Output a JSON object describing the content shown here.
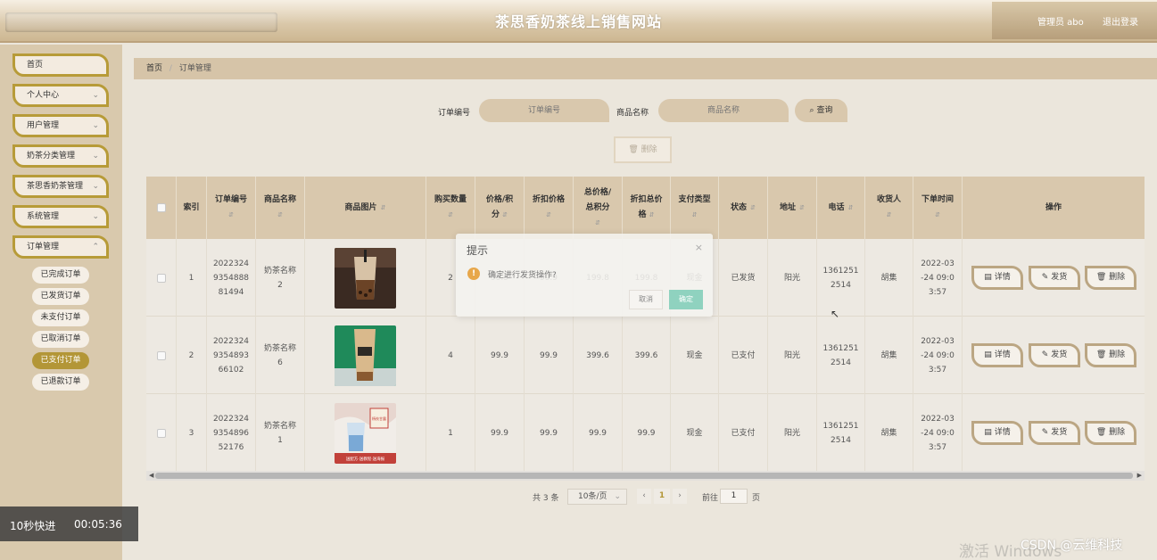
{
  "header": {
    "title": "茶思香奶茶线上销售网站",
    "admin_label": "管理员 abo",
    "logout_label": "退出登录"
  },
  "sidebar": {
    "items": [
      {
        "label": "首页",
        "has_chevron": false
      },
      {
        "label": "个人中心",
        "has_chevron": true
      },
      {
        "label": "用户管理",
        "has_chevron": true
      },
      {
        "label": "奶茶分类管理",
        "has_chevron": true
      },
      {
        "label": "茶思香奶茶管理",
        "has_chevron": true
      },
      {
        "label": "系统管理",
        "has_chevron": true
      },
      {
        "label": "订单管理",
        "has_chevron": true
      }
    ],
    "sub_items": [
      {
        "label": "已完成订单",
        "active": false
      },
      {
        "label": "已发货订单",
        "active": false
      },
      {
        "label": "未支付订单",
        "active": false
      },
      {
        "label": "已取消订单",
        "active": false
      },
      {
        "label": "已支付订单",
        "active": true
      },
      {
        "label": "已退款订单",
        "active": false
      }
    ]
  },
  "breadcrumb": {
    "home": "首页",
    "separator": "/",
    "current": "订单管理"
  },
  "search": {
    "order_no_label": "订单编号",
    "order_no_placeholder": "订单编号",
    "product_name_label": "商品名称",
    "product_name_placeholder": "商品名称",
    "query_label": "查询",
    "delete_label": "删除"
  },
  "table": {
    "headers": {
      "index": "索引",
      "order_no": "订单编号",
      "product_name": "商品名称",
      "product_image": "商品图片",
      "quantity": "购买数量",
      "price_line1": "价格/积",
      "price_line2": "分",
      "discount_price": "折扣价格",
      "total_line1": "总价格/",
      "total_line2": "总积分",
      "discount_total_line1": "折扣总价",
      "discount_total_line2": "格",
      "pay_type_line1": "支付类型",
      "status": "状态",
      "address": "地址",
      "phone": "电话",
      "receiver": "收货人",
      "order_time": "下单时间",
      "actions": "操作"
    },
    "rows": [
      {
        "index": "1",
        "order_no_1": "2022324",
        "order_no_2": "9354888",
        "order_no_3": "81494",
        "product_1": "奶茶名称",
        "product_2": "2",
        "quantity": "2",
        "price": "99.9",
        "discount_price": "99.9",
        "total": "199.8",
        "discount_total": "199.8",
        "pay_type": "现金",
        "status": "已发货",
        "address": "阳光",
        "phone_1": "1361251",
        "phone_2": "2514",
        "receiver": "胡集",
        "time_1": "2022-03",
        "time_2": "-24 09:0",
        "time_3": "3:57",
        "image_kind": "boba"
      },
      {
        "index": "2",
        "order_no_1": "2022324",
        "order_no_2": "9354893",
        "order_no_3": "66102",
        "product_1": "奶茶名称",
        "product_2": "6",
        "quantity": "4",
        "price": "99.9",
        "discount_price": "99.9",
        "total": "399.6",
        "discount_total": "399.6",
        "pay_type": "现金",
        "status": "已支付",
        "address": "阳光",
        "phone_1": "1361251",
        "phone_2": "2514",
        "receiver": "胡集",
        "time_1": "2022-03",
        "time_2": "-24 09:0",
        "time_3": "3:57",
        "image_kind": "tall"
      },
      {
        "index": "3",
        "order_no_1": "2022324",
        "order_no_2": "9354896",
        "order_no_3": "52176",
        "product_1": "奶茶名称",
        "product_2": "1",
        "quantity": "1",
        "price": "99.9",
        "discount_price": "99.9",
        "total": "99.9",
        "discount_total": "99.9",
        "pay_type": "现金",
        "status": "已支付",
        "address": "阳光",
        "phone_1": "1361251",
        "phone_2": "2514",
        "receiver": "胡集",
        "time_1": "2022-03",
        "time_2": "-24 09:0",
        "time_3": "3:57",
        "image_kind": "poster"
      }
    ],
    "action_labels": {
      "detail": "详情",
      "ship": "发货",
      "delete": "删除"
    },
    "image_texts": {
      "poster_banner": "送配方·送教程·送海报",
      "poster_tag": "杨枝甘露"
    }
  },
  "pagination": {
    "total": "共 3 条",
    "page_size": "10条/页",
    "prev": "‹",
    "current_page": "1",
    "next": "›",
    "goto_label": "前往",
    "goto_value": "1",
    "page_suffix": "页"
  },
  "dialog": {
    "title": "提示",
    "close": "×",
    "warn_icon": "!",
    "message": "确定进行发货操作?",
    "cancel_label": "取消",
    "confirm_label": "确定"
  },
  "overlay": {
    "speed_label": "10秒快进",
    "time": "00:05:36",
    "activate_windows": "激活 Windows",
    "csdn": "CSDN @云维科技"
  },
  "colors": {
    "accent_gold": "#b39637",
    "header_beige": "#d9c7a8",
    "table_header": "#d9c8ad",
    "confirm_green": "#8fd2bf",
    "warning_orange": "#e7a74a"
  }
}
